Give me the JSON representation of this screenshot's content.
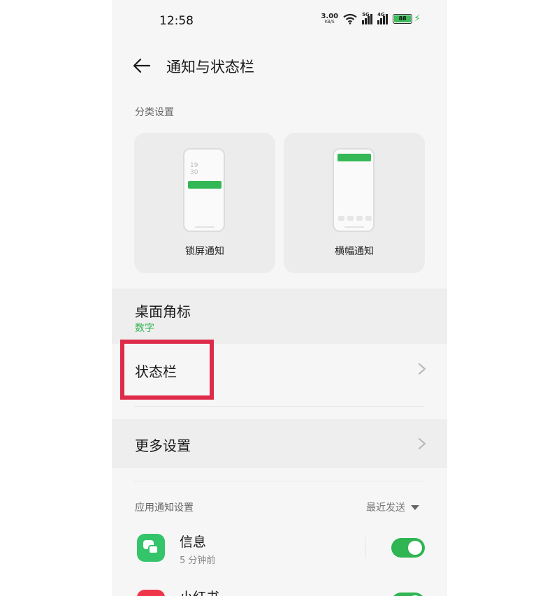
{
  "status_bar": {
    "time": "12:58",
    "net_speed": "3.00",
    "net_speed_unit": "KB/S",
    "sim1_type": "5G",
    "sim2_type": "4G",
    "battery_level": "88",
    "icons": [
      "wifi-icon",
      "signal-icon",
      "battery-icon",
      "charging-icon"
    ]
  },
  "header": {
    "title": "通知与状态栏",
    "back_icon": "back-arrow-icon"
  },
  "category": {
    "section_label": "分类设置",
    "cards": [
      {
        "label": "锁屏通知",
        "preview_clock": "19\n30"
      },
      {
        "label": "横幅通知"
      }
    ]
  },
  "rows": {
    "badge": {
      "title": "桌面角标",
      "value": "数字"
    },
    "status_bar": {
      "title": "状态栏"
    },
    "more_settings": {
      "title": "更多设置"
    }
  },
  "app_notifications": {
    "section_label": "应用通知设置",
    "sort_label": "最近发送",
    "apps": [
      {
        "name": "信息",
        "time": "5 分钟前",
        "enabled": true
      },
      {
        "name": "小红书",
        "time": "",
        "enabled": true
      }
    ]
  },
  "colors": {
    "accent": "#2fb552",
    "highlight_box": "#de2b49",
    "background": "#f6f6f6"
  }
}
